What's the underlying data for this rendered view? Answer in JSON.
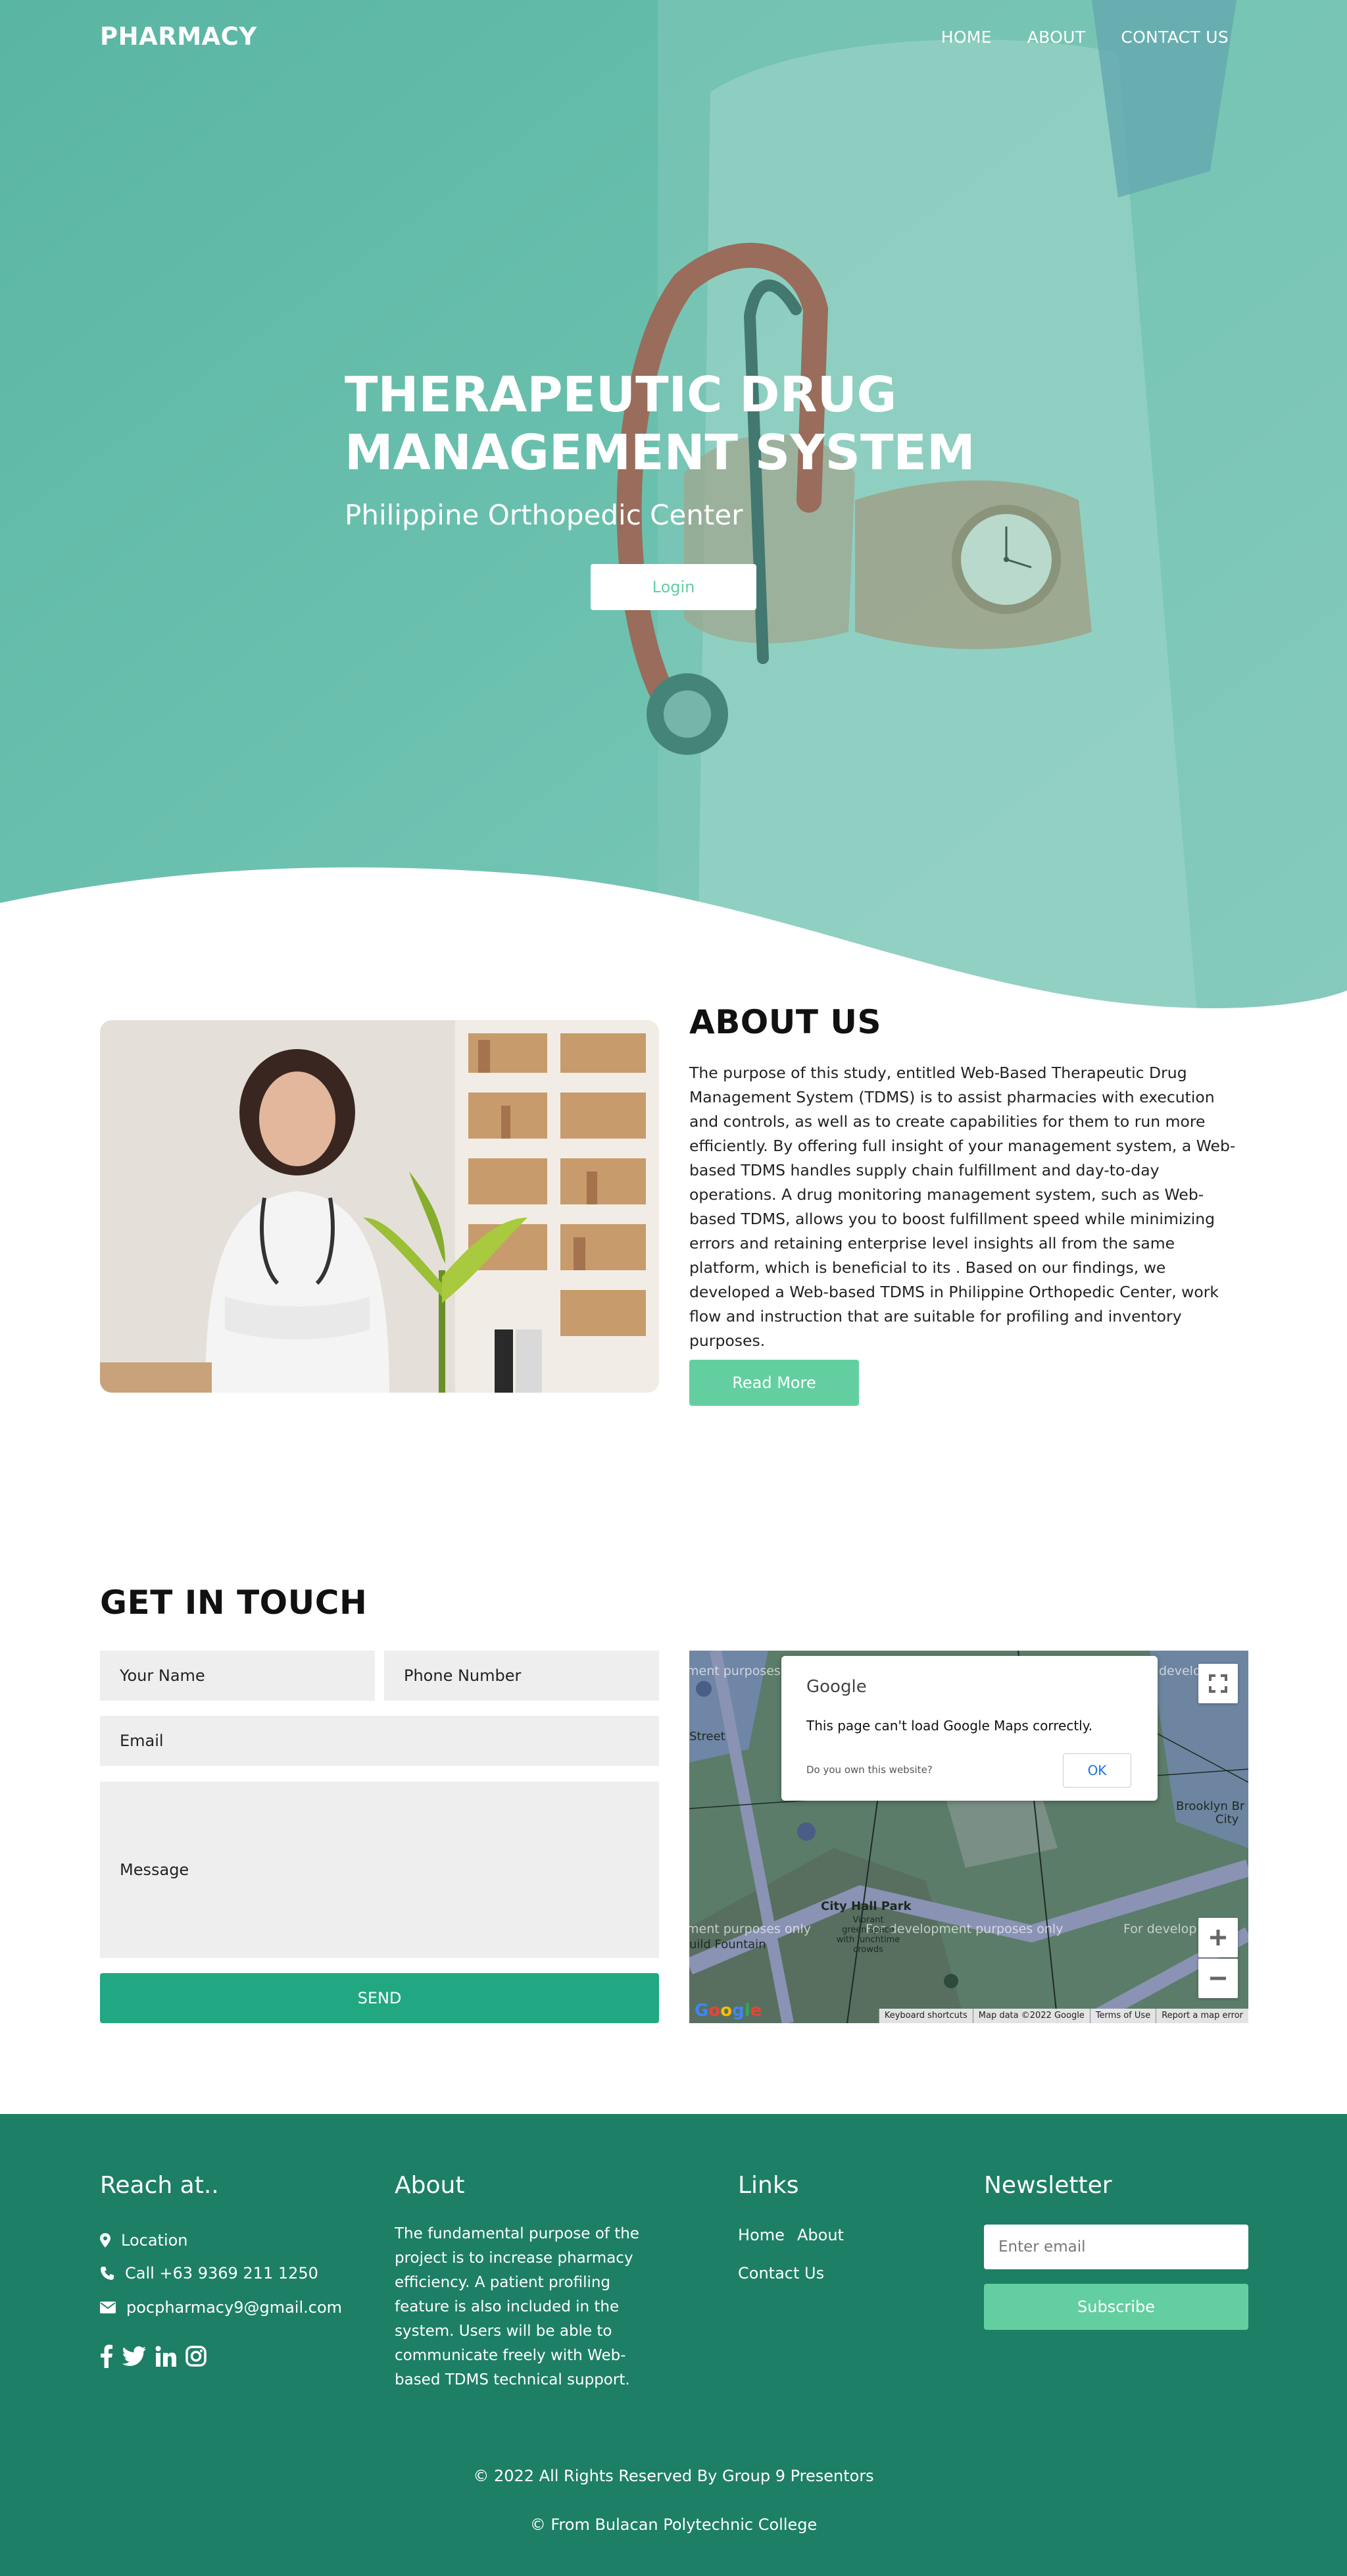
{
  "header": {
    "brand": "PHARMACY",
    "nav": [
      "HOME",
      "ABOUT",
      "CONTACT US"
    ]
  },
  "hero": {
    "title": "THERAPEUTIC DRUG MANAGEMENT SYSTEM",
    "subtitle": "Philippine Orthopedic Center",
    "login_label": "Login"
  },
  "about": {
    "title": "ABOUT US",
    "body": "The purpose of this study, entitled Web-Based Therapeutic Drug Management System (TDMS) is to assist pharmacies with execution and controls, as well as to create capabilities for them to run more efficiently. By offering full insight of your management system, a Web-based TDMS handles supply chain fulfillment and day-to-day operations. A drug monitoring management system, such as Web-based TDMS, allows you to boost fulfillment speed while minimizing errors and retaining enterprise level insights all from the same platform, which is beneficial to its . Based on our findings, we developed a Web-based TDMS in Philippine Orthopedic Center, work flow and instruction that are suitable for profiling and inventory purposes.",
    "read_more_label": "Read More"
  },
  "contact": {
    "title": "GET IN TOUCH",
    "name_placeholder": "Your Name",
    "phone_placeholder": "Phone Number",
    "email_placeholder": "Email",
    "message_placeholder": "Message",
    "send_label": "SEND"
  },
  "map": {
    "dialog_logo": "Google",
    "dialog_message": "This page can't load Google Maps correctly.",
    "dialog_question": "Do you own this website?",
    "dialog_ok": "OK",
    "dev_label": "For development purposes only",
    "dev_label_left": "ment purposes only",
    "dev_label_right": "For develop",
    "dev_label_top_left": "ment purposes",
    "dev_label_top_right": "develop",
    "place_label": "City Hall Park",
    "place_sub": "Vibrant\ngreen space\nwith lunchtime\ncrowds",
    "place_fountain": "uild Fountain",
    "place_brooklyn": "Brooklyn Br",
    "place_city": "City",
    "place_street": "Street",
    "footer_items": [
      "Keyboard shortcuts",
      "Map data ©2022 Google",
      "Terms of Use",
      "Report a map error"
    ],
    "wordmark": "Google",
    "zoom_in": "+",
    "zoom_out": "−"
  },
  "footer": {
    "reach_title": "Reach at..",
    "location": "Location",
    "phone": "Call +63 9369 211 1250",
    "email": "pocpharmacy9@gmail.com",
    "about_title": "About",
    "about_text": "The fundamental purpose of the project is to increase pharmacy efficiency. A patient profiling feature is also included in the system. Users will be able to communicate freely with Web-based TDMS technical support.",
    "links_title": "Links",
    "links": [
      "Home",
      "About",
      "Contact Us"
    ],
    "newsletter_title": "Newsletter",
    "newsletter_placeholder": "Enter email",
    "subscribe_label": "Subscribe",
    "copyright": "© 2022 All Rights Reserved By Group 9 Presentors",
    "from": "© From Bulacan Polytechnic College"
  },
  "colors": {
    "hero_teal": "#6fc2b1",
    "accent_green": "#63cfa0",
    "send_green": "#21a883",
    "footer_green": "#1d7f66"
  }
}
